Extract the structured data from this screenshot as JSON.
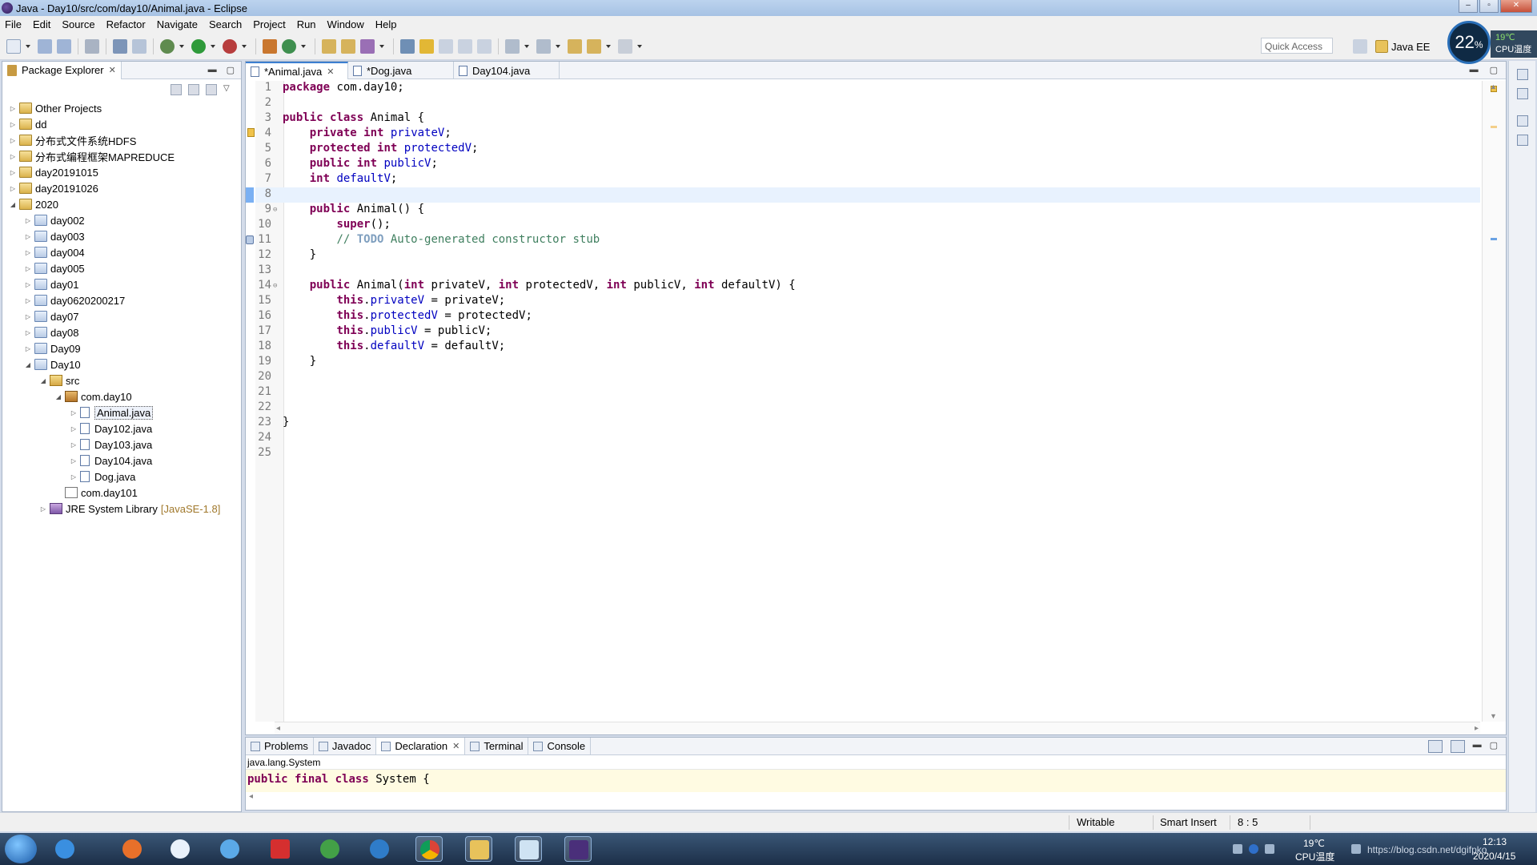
{
  "window": {
    "title": "Java - Day10/src/com/day10/Animal.java - Eclipse"
  },
  "menu": [
    "File",
    "Edit",
    "Source",
    "Refactor",
    "Navigate",
    "Search",
    "Project",
    "Run",
    "Window",
    "Help"
  ],
  "toolbar": {
    "quick_access_placeholder": "Quick Access",
    "perspective_label": "Java EE"
  },
  "cpu_widget": {
    "percent": "22",
    "percent_unit": "%",
    "temp": "19℃",
    "label": "CPU温度"
  },
  "package_explorer": {
    "title": "Package Explorer",
    "tree": [
      {
        "label": "Other Projects",
        "depth": 0,
        "twisty": "▷",
        "icon": "project-folder-icon"
      },
      {
        "label": "dd",
        "depth": 0,
        "twisty": "▷",
        "icon": "project-folder-icon"
      },
      {
        "label": "分布式文件系统HDFS",
        "depth": 0,
        "twisty": "▷",
        "icon": "project-folder-icon"
      },
      {
        "label": "分布式编程框架MAPREDUCE",
        "depth": 0,
        "twisty": "▷",
        "icon": "project-folder-icon"
      },
      {
        "label": "day20191015",
        "depth": 0,
        "twisty": "▷",
        "icon": "project-folder-icon"
      },
      {
        "label": "day20191026",
        "depth": 0,
        "twisty": "▷",
        "icon": "project-folder-icon"
      },
      {
        "label": "2020",
        "depth": 0,
        "twisty": "◢",
        "icon": "project-folder-icon"
      },
      {
        "label": "day002",
        "depth": 1,
        "twisty": "▷",
        "icon": "java-project-icon"
      },
      {
        "label": "day003",
        "depth": 1,
        "twisty": "▷",
        "icon": "java-project-icon"
      },
      {
        "label": "day004",
        "depth": 1,
        "twisty": "▷",
        "icon": "java-project-icon"
      },
      {
        "label": "day005",
        "depth": 1,
        "twisty": "▷",
        "icon": "java-project-icon"
      },
      {
        "label": "day01",
        "depth": 1,
        "twisty": "▷",
        "icon": "java-project-icon"
      },
      {
        "label": "day0620200217",
        "depth": 1,
        "twisty": "▷",
        "icon": "java-project-icon"
      },
      {
        "label": "day07",
        "depth": 1,
        "twisty": "▷",
        "icon": "java-project-icon"
      },
      {
        "label": "day08",
        "depth": 1,
        "twisty": "▷",
        "icon": "java-project-icon"
      },
      {
        "label": "Day09",
        "depth": 1,
        "twisty": "▷",
        "icon": "java-project-icon"
      },
      {
        "label": "Day10",
        "depth": 1,
        "twisty": "◢",
        "icon": "java-project-icon"
      },
      {
        "label": "src",
        "depth": 2,
        "twisty": "◢",
        "icon": "source-folder-icon"
      },
      {
        "label": "com.day10",
        "depth": 3,
        "twisty": "◢",
        "icon": "package-icon"
      },
      {
        "label": "Animal.java",
        "depth": 4,
        "twisty": "▷",
        "icon": "java-file-icon",
        "selected": true
      },
      {
        "label": "Day102.java",
        "depth": 4,
        "twisty": "▷",
        "icon": "java-file-icon"
      },
      {
        "label": "Day103.java",
        "depth": 4,
        "twisty": "▷",
        "icon": "java-file-icon"
      },
      {
        "label": "Day104.java",
        "depth": 4,
        "twisty": "▷",
        "icon": "java-file-icon"
      },
      {
        "label": "Dog.java",
        "depth": 4,
        "twisty": "▷",
        "icon": "java-file-icon"
      },
      {
        "label": "com.day101",
        "depth": 3,
        "twisty": "",
        "icon": "empty-package-icon"
      },
      {
        "label": "JRE System Library",
        "suffix": "[JavaSE-1.8]",
        "depth": 2,
        "twisty": "▷",
        "icon": "library-icon"
      }
    ]
  },
  "editor": {
    "tabs": [
      {
        "label": "*Animal.java",
        "active": true
      },
      {
        "label": "*Dog.java",
        "active": false
      },
      {
        "label": "Day104.java",
        "active": false
      }
    ],
    "lines": [
      [
        [
          "kw",
          "package"
        ],
        [
          "t",
          " com.day10;"
        ]
      ],
      [],
      [
        [
          "kw",
          "public"
        ],
        [
          "t",
          " "
        ],
        [
          "kw",
          "class"
        ],
        [
          "t",
          " Animal {"
        ]
      ],
      [
        [
          "t",
          "    "
        ],
        [
          "kw",
          "private"
        ],
        [
          "t",
          " "
        ],
        [
          "kw",
          "int"
        ],
        [
          "t",
          " "
        ],
        [
          "fld",
          "privateV"
        ],
        [
          "t",
          ";"
        ]
      ],
      [
        [
          "t",
          "    "
        ],
        [
          "kw",
          "protected"
        ],
        [
          "t",
          " "
        ],
        [
          "kw",
          "int"
        ],
        [
          "t",
          " "
        ],
        [
          "fld",
          "protectedV"
        ],
        [
          "t",
          ";"
        ]
      ],
      [
        [
          "t",
          "    "
        ],
        [
          "kw",
          "public"
        ],
        [
          "t",
          " "
        ],
        [
          "kw",
          "int"
        ],
        [
          "t",
          " "
        ],
        [
          "fld",
          "publicV"
        ],
        [
          "t",
          ";"
        ]
      ],
      [
        [
          "t",
          "    "
        ],
        [
          "kw",
          "int"
        ],
        [
          "t",
          " "
        ],
        [
          "fld",
          "defaultV"
        ],
        [
          "t",
          ";"
        ]
      ],
      [],
      [
        [
          "t",
          "    "
        ],
        [
          "kw",
          "public"
        ],
        [
          "t",
          " Animal() {"
        ]
      ],
      [
        [
          "t",
          "        "
        ],
        [
          "kw",
          "super"
        ],
        [
          "t",
          "();"
        ]
      ],
      [
        [
          "t",
          "        "
        ],
        [
          "cmt",
          "// "
        ],
        [
          "todo",
          "TODO"
        ],
        [
          "cmt",
          " Auto-generated constructor stub"
        ]
      ],
      [
        [
          "t",
          "    }"
        ]
      ],
      [],
      [
        [
          "t",
          "    "
        ],
        [
          "kw",
          "public"
        ],
        [
          "t",
          " Animal("
        ],
        [
          "kw",
          "int"
        ],
        [
          "t",
          " privateV, "
        ],
        [
          "kw",
          "int"
        ],
        [
          "t",
          " protectedV, "
        ],
        [
          "kw",
          "int"
        ],
        [
          "t",
          " publicV, "
        ],
        [
          "kw",
          "int"
        ],
        [
          "t",
          " defaultV) {"
        ]
      ],
      [
        [
          "t",
          "        "
        ],
        [
          "kw",
          "this"
        ],
        [
          "t",
          "."
        ],
        [
          "fld",
          "privateV"
        ],
        [
          "t",
          " = privateV;"
        ]
      ],
      [
        [
          "t",
          "        "
        ],
        [
          "kw",
          "this"
        ],
        [
          "t",
          "."
        ],
        [
          "fld",
          "protectedV"
        ],
        [
          "t",
          " = protectedV;"
        ]
      ],
      [
        [
          "t",
          "        "
        ],
        [
          "kw",
          "this"
        ],
        [
          "t",
          "."
        ],
        [
          "fld",
          "publicV"
        ],
        [
          "t",
          " = publicV;"
        ]
      ],
      [
        [
          "t",
          "        "
        ],
        [
          "kw",
          "this"
        ],
        [
          "t",
          "."
        ],
        [
          "fld",
          "defaultV"
        ],
        [
          "t",
          " = defaultV;"
        ]
      ],
      [
        [
          "t",
          "    }"
        ]
      ],
      [],
      [],
      [],
      [
        [
          "t",
          "}"
        ]
      ],
      [],
      []
    ],
    "current_line": 8,
    "fold_lines": [
      9,
      14
    ],
    "warning_line": 4,
    "override_line": 11
  },
  "bottom_panel": {
    "tabs": [
      {
        "label": "Problems",
        "active": false
      },
      {
        "label": "Javadoc",
        "active": false
      },
      {
        "label": "Declaration",
        "active": true
      },
      {
        "label": "Terminal",
        "active": false
      },
      {
        "label": "Console",
        "active": false
      }
    ],
    "declaration_title": "java.lang.System",
    "declaration_code": [
      [
        "kw",
        "public"
      ],
      [
        "t",
        " "
      ],
      [
        "kw",
        "final"
      ],
      [
        "t",
        " "
      ],
      [
        "kw",
        "class"
      ],
      [
        "t",
        " System {"
      ]
    ]
  },
  "status": {
    "writable": "Writable",
    "insert_mode": "Smart Insert",
    "position": "8 : 5"
  },
  "taskbar": {
    "temp": "19℃",
    "temp_label": "CPU温度",
    "time": "12:13",
    "date": "2020/4/15",
    "watermark": "https://blog.csdn.net/dgifpko"
  },
  "colors": {
    "keyword": "#7f0055",
    "field": "#0000c0",
    "comment": "#3f7f5f",
    "current_line": "#e8f2fe"
  }
}
